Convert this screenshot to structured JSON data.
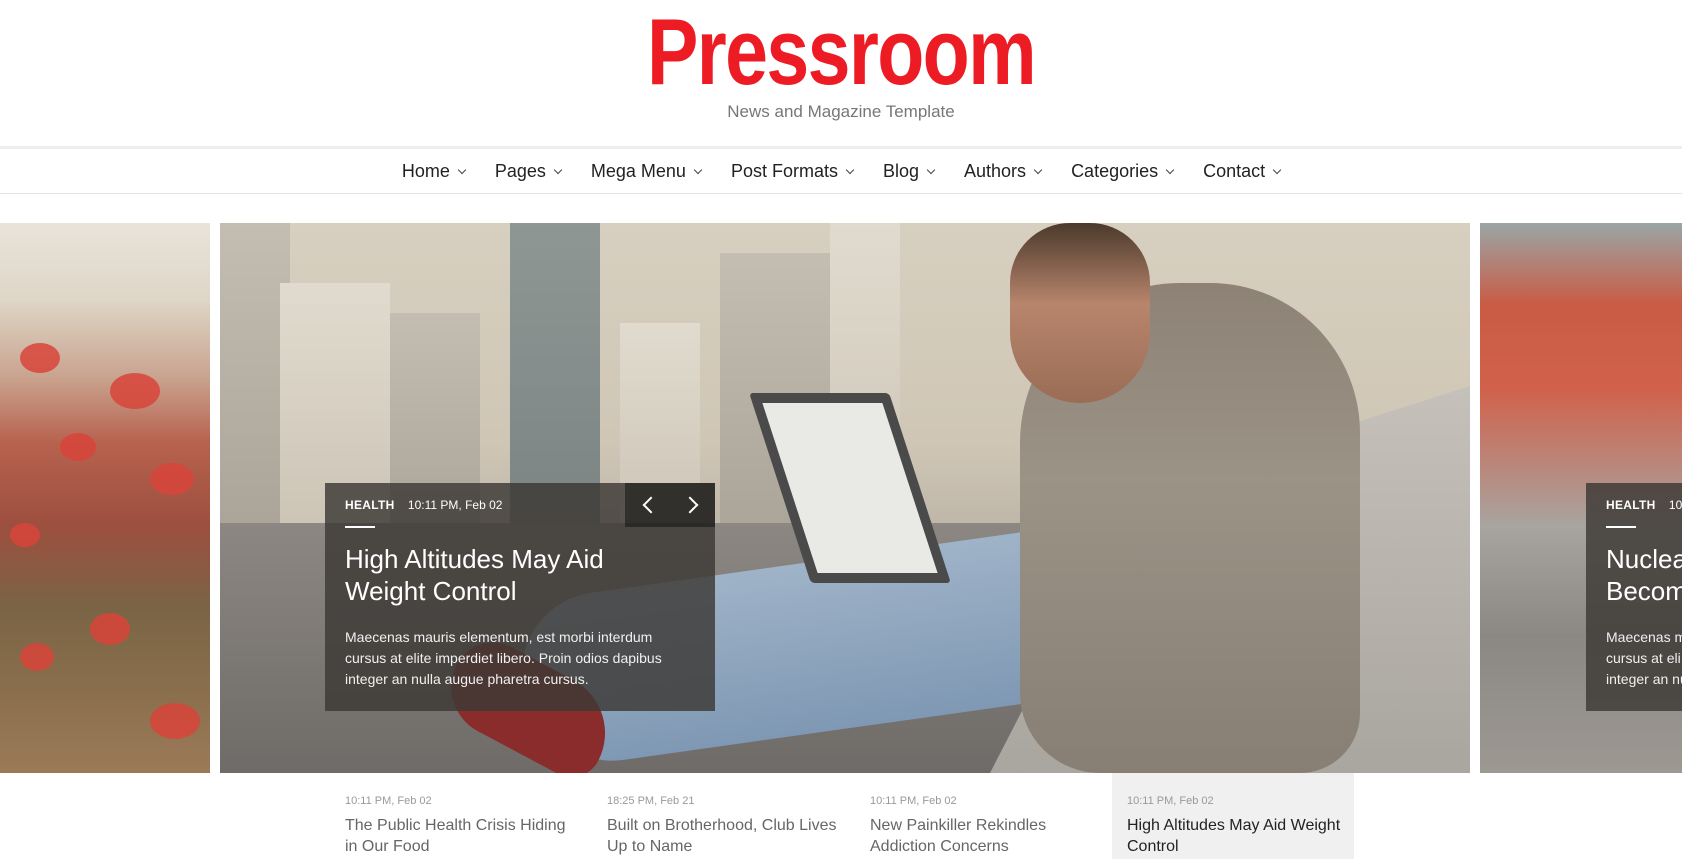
{
  "site": {
    "logo": "Pressroom",
    "tagline": "News and Magazine Template"
  },
  "nav": {
    "items": [
      {
        "label": "Home"
      },
      {
        "label": "Pages"
      },
      {
        "label": "Mega Menu"
      },
      {
        "label": "Post Formats"
      },
      {
        "label": "Blog"
      },
      {
        "label": "Authors"
      },
      {
        "label": "Categories"
      },
      {
        "label": "Contact"
      }
    ]
  },
  "slider": {
    "main": {
      "category": "HEALTH",
      "date": "10:11 PM, Feb 02",
      "title_line1": "High Altitudes May Aid",
      "title_line2": "Weight Control",
      "excerpt": "Maecenas mauris elementum, est morbi interdum cursus at elite imperdiet libero. Proin odios dapibus integer an nulla augue pharetra cursus."
    },
    "next": {
      "category": "HEALTH",
      "date": "10:1",
      "title_line1": "Nuclea",
      "title_line2": "Becom",
      "excerpt_line1": "Maecenas m",
      "excerpt_line2": "cursus at eli",
      "excerpt_line3": "integer an nu"
    }
  },
  "thumbnails": [
    {
      "date": "10:11 PM, Feb 02",
      "title": "The Public Health Crisis Hiding in Our Food",
      "active": false
    },
    {
      "date": "18:25 PM, Feb 21",
      "title": "Built on Brotherhood, Club Lives Up to Name",
      "active": false
    },
    {
      "date": "10:11 PM, Feb 02",
      "title": "New Painkiller Rekindles Addiction Concerns",
      "active": false
    },
    {
      "date": "10:11 PM, Feb 02",
      "title": "High Altitudes May Aid Weight Control",
      "active": true
    }
  ],
  "colors": {
    "brand": "#ed1c24",
    "caption_bg": "#3c3834",
    "active_thumb_bg": "#f0f0f0"
  }
}
